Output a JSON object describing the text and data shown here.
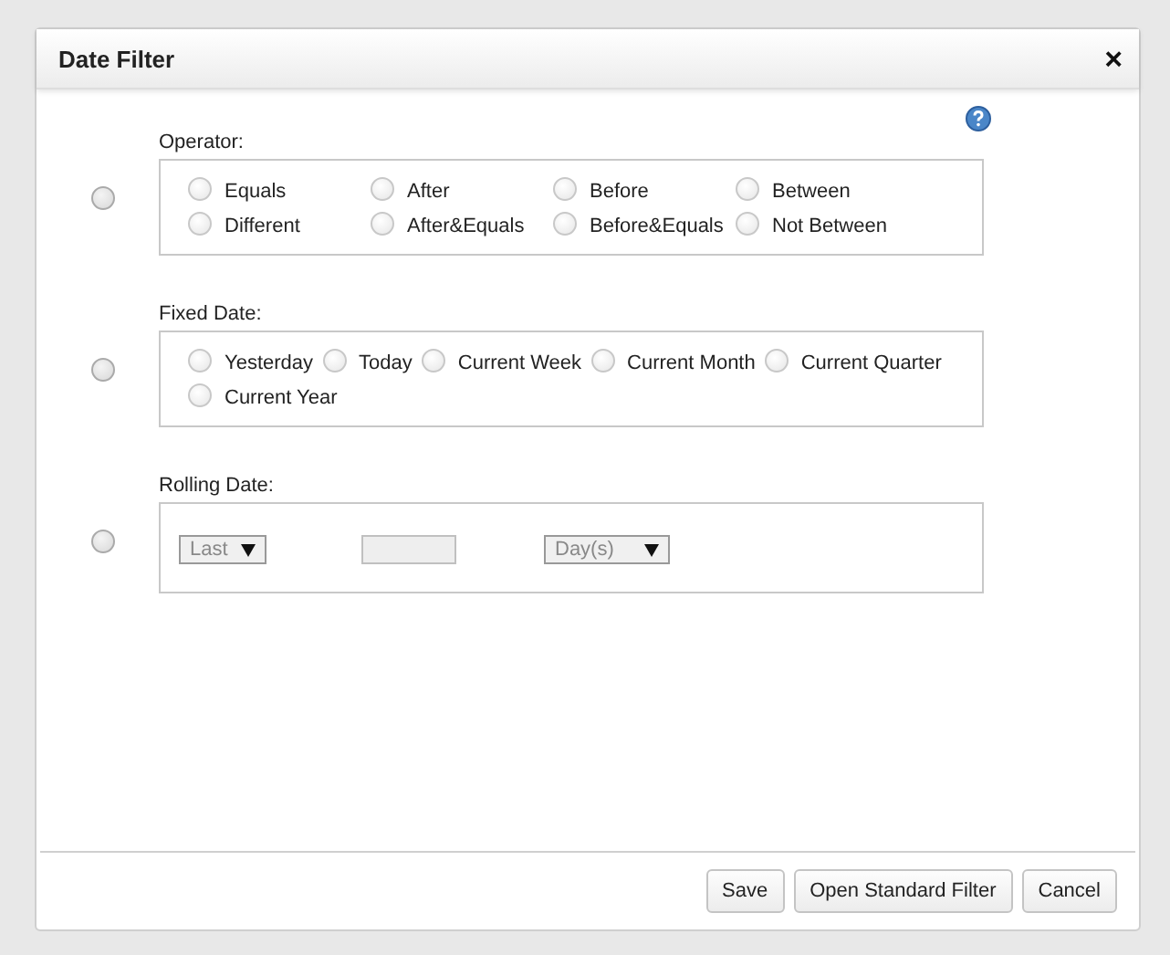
{
  "window": {
    "title": "Date Filter",
    "close": "×"
  },
  "sections": [
    {
      "kind": "operator",
      "label": "Operator:",
      "selected": false,
      "options": [
        {
          "label": "Equals",
          "selected": false
        },
        {
          "label": "After",
          "selected": false
        },
        {
          "label": "Before",
          "selected": false
        },
        {
          "label": "Between",
          "selected": false
        },
        {
          "label": "Different",
          "selected": false
        },
        {
          "label": "After&Equals",
          "selected": false
        },
        {
          "label": "Before&Equals",
          "selected": false
        },
        {
          "label": "Not Between",
          "selected": false
        }
      ]
    },
    {
      "kind": "fixed",
      "label": "Fixed Date:",
      "selected": false,
      "options": [
        {
          "label": "Yesterday",
          "selected": false
        },
        {
          "label": "Today",
          "selected": false
        },
        {
          "label": "Current Week",
          "selected": false
        },
        {
          "label": "Current Month",
          "selected": false
        },
        {
          "label": "Current Quarter",
          "selected": false
        },
        {
          "label": "Current Year",
          "selected": false
        }
      ]
    },
    {
      "kind": "rolling",
      "label": "Rolling Date:",
      "selected": false,
      "direction": "Last",
      "unit": "Day(s)",
      "disabled": true
    }
  ],
  "buttons": [
    "Save",
    "Open Standard Filter",
    "Cancel"
  ]
}
